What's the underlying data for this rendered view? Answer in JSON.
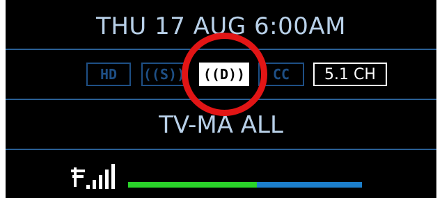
{
  "header": {
    "datetime": "THU 17 AUG 6:00AM"
  },
  "badges": [
    {
      "label": "HD",
      "active": false
    },
    {
      "label": "((S))",
      "active": false
    },
    {
      "label": "((D))",
      "active": true
    },
    {
      "label": "CC",
      "active": false
    },
    {
      "label": "5.1 CH",
      "active": true
    }
  ],
  "rating": {
    "text": "TV-MA ALL"
  },
  "signal": {
    "icon": "signal-strength-icon",
    "bars": 5,
    "strength_percent": 55
  },
  "colors": {
    "text": "#b8d0e8",
    "divider": "#2a5f94",
    "badge_inactive": "#1e4f85",
    "meter_good": "#2ad32a",
    "meter_rest": "#1c7fcc",
    "highlight": "#e21515"
  }
}
